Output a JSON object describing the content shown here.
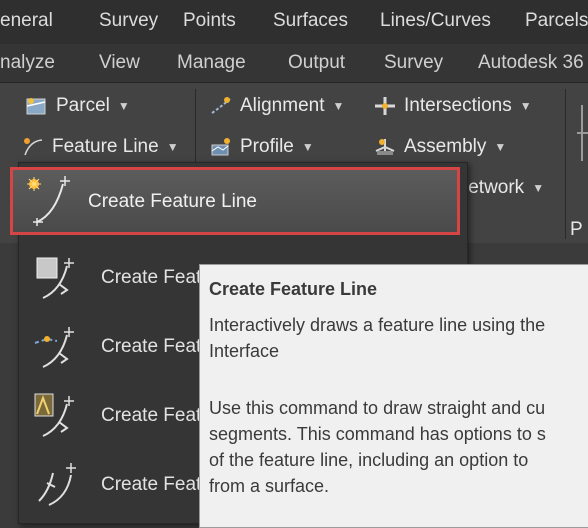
{
  "tabs_row1": [
    "eneral",
    "Survey",
    "Points",
    "Surfaces",
    "Lines/Curves",
    "Parcels"
  ],
  "tabs_row2": [
    "nalyze",
    "View",
    "Manage",
    "Output",
    "Survey",
    "Autodesk 36"
  ],
  "panel": {
    "parcel": "Parcel",
    "feature_line": "Feature Line",
    "alignment": "Alignment",
    "profile": "Profile",
    "intersections": "Intersections",
    "assembly": "Assembly",
    "network": "letwork",
    "partial_right": "P"
  },
  "dropdown": {
    "highlighted": "Create Feature Line",
    "items": [
      "Create Featu",
      "Create Featu",
      "Create Featu",
      "Create Featu"
    ]
  },
  "tooltip": {
    "title": "Create Feature Line",
    "lines1": [
      "Interactively draws a feature line using the",
      "Interface"
    ],
    "lines2": [
      "Use this command to draw straight and cu",
      "segments. This command has options to s",
      "of the feature line, including an option to",
      "from a surface."
    ]
  }
}
